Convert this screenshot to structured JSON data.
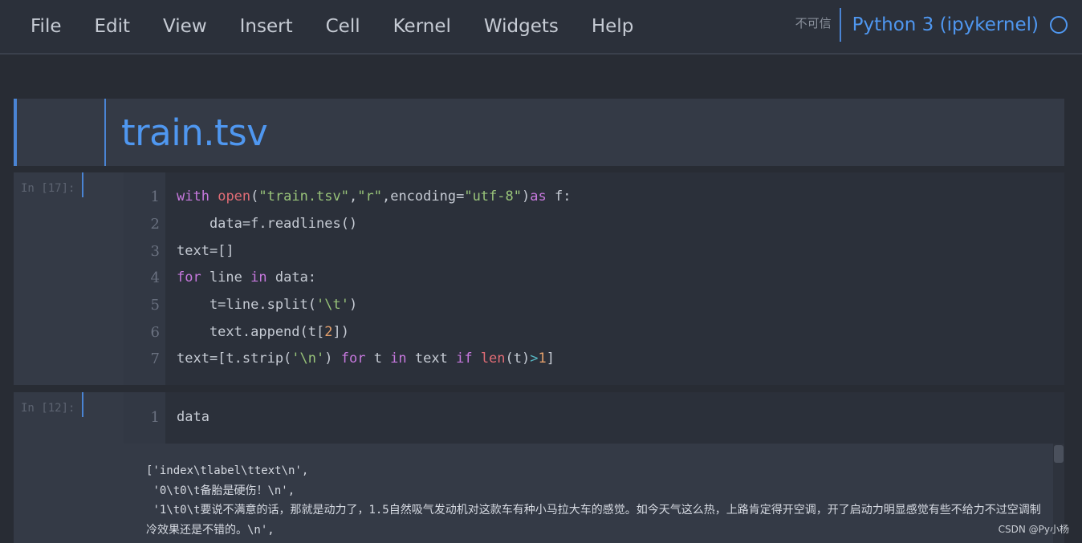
{
  "menu": {
    "items": [
      "File",
      "Edit",
      "View",
      "Insert",
      "Cell",
      "Kernel",
      "Widgets",
      "Help"
    ]
  },
  "kernel": {
    "trust_label": "不可信",
    "name": "Python 3 (ipykernel)",
    "status_icon": "circle-outline-icon"
  },
  "markdown_cell": {
    "title": "train.tsv"
  },
  "code_cell_1": {
    "prompt": "In [17]:",
    "line_numbers": [
      "1",
      "2",
      "3",
      "4",
      "5",
      "6",
      "7"
    ]
  },
  "code_cell_2": {
    "prompt": "In [12]:",
    "line_numbers": [
      "1"
    ],
    "code": "data"
  },
  "output": {
    "lines": [
      "['index\\tlabel\\ttext\\n',",
      " '0\\t0\\t备胎是硬伤！\\n',",
      " '1\\t0\\t要说不满意的话，那就是动力了，1.5自然吸气发动机对这款车有种小马拉大车的感觉。如今天气这么热，上路肯定得开空调，开了启动力明显感觉有些不给力不过空调制冷效果还是不错的。\\n',"
    ]
  },
  "watermark": "CSDN @Py小杨",
  "colors": {
    "accent": "#4f97f0",
    "keyword": "#c678dd",
    "function": "#e06c75",
    "string": "#98c379",
    "number": "#e5a06b"
  }
}
